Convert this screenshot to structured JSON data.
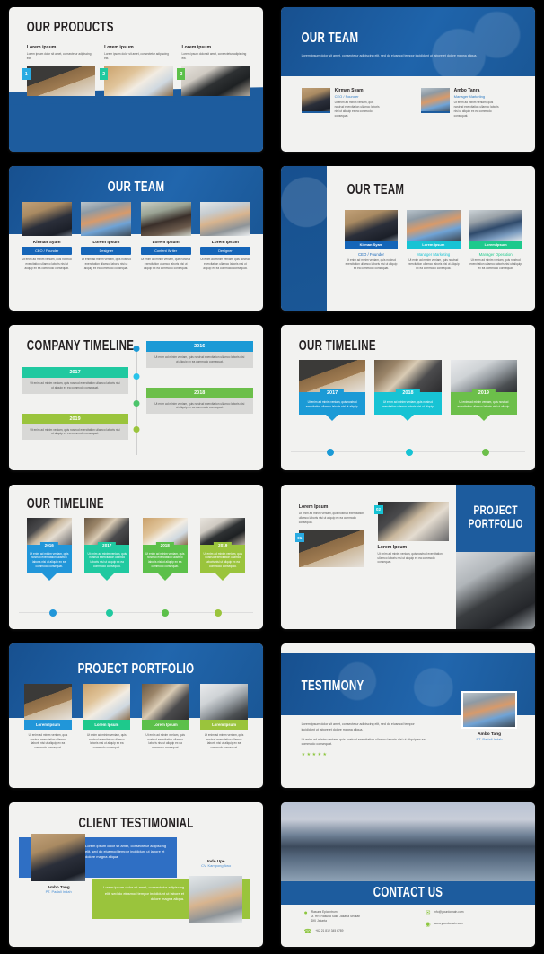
{
  "deck": {
    "slides": [
      {
        "id": "our-products",
        "title": "OUR PRODUCTS",
        "columns": [
          {
            "num": "1",
            "heading": "Lorem ipsum",
            "body": "Lorem ipsum dolor sit amet, consectetur adipiscing elit.",
            "color": "#29abe2"
          },
          {
            "num": "2",
            "heading": "Lorem ipsum",
            "body": "Lorem ipsum dolor sit amet, consectetur adipiscing elit.",
            "color": "#1ec9a0"
          },
          {
            "num": "3",
            "heading": "Lorem ipsum",
            "body": "Lorem ipsum dolor sit amet, consectetur adipiscing elit.",
            "color": "#5cc04a"
          }
        ]
      },
      {
        "id": "our-team-hero",
        "title": "OUR TEAM",
        "subtitle": "Lorem ipsum dolor sit amet, consectetur adipiscing elit, sed do eiusmod tempor incididunt ut labore et dolore magna aliqua.",
        "members": [
          {
            "name": "Kirman Syam",
            "role": "CEO / Founder",
            "body": "Ut enim ad minim veniam, quis nostrud exercitation ullamco laboris nisi ut aliquip ex ea commodo consequat."
          },
          {
            "name": "Ambo Tanra",
            "role": "Manager Marketing",
            "body": "Ut enim ad minim veniam, quis nostrud exercitation ullamco laboris nisi ut aliquip ex ea commodo consequat."
          }
        ]
      },
      {
        "id": "our-team-four",
        "title": "OUR TEAM",
        "members": [
          {
            "name": "Kirman Syam",
            "role": "CEO / Founder",
            "body": "Ut enim ad minim veniam, quis nostrud exercitation ullamco laboris nisi ut aliquip ex ea commodo consequat."
          },
          {
            "name": "Lorem Ipsum",
            "role": "Designer",
            "body": "Ut enim ad minim veniam, quis nostrud exercitation ullamco laboris nisi ut aliquip ex ea commodo consequat."
          },
          {
            "name": "Lorem Ipsum",
            "role": "Content Writer",
            "body": "Ut enim ad minim veniam, quis nostrud exercitation ullamco laboris nisi ut aliquip ex ea commodo consequat."
          },
          {
            "name": "Lorem Ipsum",
            "role": "Designer",
            "body": "Ut enim ad minim veniam, quis nostrud exercitation ullamco laboris nisi ut aliquip ex ea commodo consequat."
          }
        ]
      },
      {
        "id": "our-team-three",
        "title": "OUR TEAM",
        "members": [
          {
            "name": "Kirman Syam",
            "role": "CEO / Founder",
            "color": "#1565b8",
            "body": "Ut enim ad minim veniam, quis nostrud exercitation ullamco laboris nisi ut aliquip ex ea commodo consequat."
          },
          {
            "name": "Lorem Ipsum",
            "role": "Manager Marketing",
            "color": "#17c3d4",
            "body": "Ut enim ad minim veniam, quis nostrud exercitation ullamco laboris nisi ut aliquip ex ea commodo consequat."
          },
          {
            "name": "Lorem Ipsum",
            "role": "Manager Operation",
            "color": "#1ec98c",
            "body": "Ut enim ad minim veniam, quis nostrud exercitation ullamco laboris nisi ut aliquip ex ea commodo consequat."
          }
        ]
      },
      {
        "id": "company-timeline",
        "title": "COMPANY TIMELINE",
        "entries": [
          {
            "year": "2016",
            "side": "right",
            "color": "#1b9ad6",
            "body": "Ut enim ad minim veniam, quis nostrud exercitation ullamco laboris nisi ut aliquip ex ea commodo consequat."
          },
          {
            "year": "2017",
            "side": "left",
            "color": "#20c9a0",
            "body": "Ut enim ad minim veniam, quis nostrud exercitation ullamco laboris nisi ut aliquip ex ea commodo consequat."
          },
          {
            "year": "2018",
            "side": "right",
            "color": "#6cbf4a",
            "body": "Ut enim ad minim veniam, quis nostrud exercitation ullamco laboris nisi ut aliquip ex ea commodo consequat."
          },
          {
            "year": "2019",
            "side": "left",
            "color": "#9ac43c",
            "body": "Ut enim ad minim veniam, quis nostrud exercitation ullamco laboris nisi ut aliquip ex ea commodo consequat."
          }
        ]
      },
      {
        "id": "our-timeline-three",
        "title": "OUR TIMELINE",
        "entries": [
          {
            "year": "2017",
            "color": "#1b9ad6",
            "body": "Ut enim ad minim veniam, quis nostrud exercitation ullamco laboris nisi ut aliquip."
          },
          {
            "year": "2018",
            "color": "#17c3d4",
            "body": "Ut enim ad minim veniam, quis nostrud exercitation ullamco laboris nisi ut aliquip."
          },
          {
            "year": "2019",
            "color": "#6cbf4a",
            "body": "Ut enim ad minim veniam, quis nostrud exercitation ullamco laboris nisi ut aliquip."
          }
        ]
      },
      {
        "id": "our-timeline-four",
        "title": "OUR TIMELINE",
        "entries": [
          {
            "year": "2016",
            "color": "#2196d9",
            "body": "Ut enim ad minim veniam, quis nostrud exercitation ullamco laboris nisi ut aliquip ex ea commodo consequat."
          },
          {
            "year": "2017",
            "color": "#20c9a0",
            "body": "Ut enim ad minim veniam, quis nostrud exercitation ullamco laboris nisi ut aliquip ex ea commodo consequat."
          },
          {
            "year": "2018",
            "color": "#5cc04a",
            "body": "Ut enim ad minim veniam, quis nostrud exercitation ullamco laboris nisi ut aliquip ex ea commodo consequat."
          },
          {
            "year": "2019",
            "color": "#9ac43c",
            "body": "Ut enim ad minim veniam, quis nostrud exercitation ullamco laboris nisi ut aliquip ex ea commodo consequat."
          }
        ]
      },
      {
        "id": "project-portfolio-split",
        "title_line1": "PROJECT",
        "title_line2": "PORTFOLIO",
        "blocks": [
          {
            "num": "01",
            "heading": "Lorem Ipsum",
            "body": "Ut enim ad minim veniam, quis nostrud exercitation ullamco laboris nisi ut aliquip ex ea commodo consequat.",
            "color": "#29abe2"
          },
          {
            "num": "02",
            "heading": "Lorem Ipsum",
            "body": "Ut enim ad minim veniam, quis nostrud exercitation ullamco laboris nisi ut aliquip ex ea commodo consequat.",
            "color": "#17c3d4"
          }
        ]
      },
      {
        "id": "project-portfolio-four",
        "title": "PROJECT PORTFOLIO",
        "items": [
          {
            "label": "Lorem Ipsum",
            "color": "#2196d9",
            "body": "Ut enim ad minim veniam, quis nostrud exercitation ullamco laboris nisi ut aliquip ex ea commodo consequat."
          },
          {
            "label": "Lorem Ipsum",
            "color": "#1ec98c",
            "body": "Ut enim ad minim veniam, quis nostrud exercitation ullamco laboris nisi ut aliquip ex ea commodo consequat."
          },
          {
            "label": "Lorem Ipsum",
            "color": "#5cc04a",
            "body": "Ut enim ad minim veniam, quis nostrud exercitation ullamco laboris nisi ut aliquip ex ea commodo consequat."
          },
          {
            "label": "Lorem Ipsum",
            "color": "#9ac43c",
            "body": "Ut enim ad minim veniam, quis nostrud exercitation ullamco laboris nisi ut aliquip ex ea commodo consequat."
          }
        ]
      },
      {
        "id": "testimony",
        "title": "TESTIMONY",
        "para1": "Lorem ipsum dolor sit amet, consectetur adipiscing elit, sed do eiusmod tempor incididunt ut labore et dolore magna aliqua.",
        "para2": "Ut enim ad minim veniam, quis nostrud exercitation ullamco laboris nisi ut aliquip ex ea commodo consequat.",
        "stars": "★★★★★",
        "author_name": "Ambo Tang",
        "author_company": "PT. Padali Indah"
      },
      {
        "id": "client-testimonial",
        "title": "CLIENT TESTIMONIAL",
        "quotes": [
          {
            "text": "Lorem ipsum dolor sit amet, consectetur adipiscing elit, sed do eiusmod tempor incididunt ut labore et dolore magna aliqua.",
            "name": "Ambo Tang",
            "company": "PT. Padali Indah",
            "color": "#2f6fc4"
          },
          {
            "text": "Lorem ipsum dolor sit amet, consectetur adipiscing elit, sed do eiusmod tempor incididunt ut labore et dolore magna aliqua.",
            "name": "Indo Upe",
            "company": "CV. Kampong Awo",
            "color": "#9ac43c"
          }
        ]
      },
      {
        "id": "contact-us",
        "title": "CONTACT US",
        "contacts": [
          {
            "icon": "location-pin-icon",
            "glyph": "⌗",
            "text": "Rasuna Epicentrum\nJl. HR. Rasuna Said, Jakarta Selatan\nDKI Jakarta"
          },
          {
            "icon": "phone-icon",
            "glyph": "✆",
            "text": "+62 21 812 345 6789"
          },
          {
            "icon": "envelope-icon",
            "glyph": "✉",
            "text": "info@yourdomain.com"
          },
          {
            "icon": "globe-icon",
            "glyph": "◉",
            "text": "www.yourdomain.com"
          }
        ]
      }
    ]
  },
  "colors": {
    "brand_blue": "#1d5c9e",
    "cyan": "#29abe2",
    "teal": "#1ec9a0",
    "green": "#5cc04a",
    "lime": "#9ac43c",
    "page_bg": "#000000",
    "slide_bg": "#f2f2f0"
  }
}
